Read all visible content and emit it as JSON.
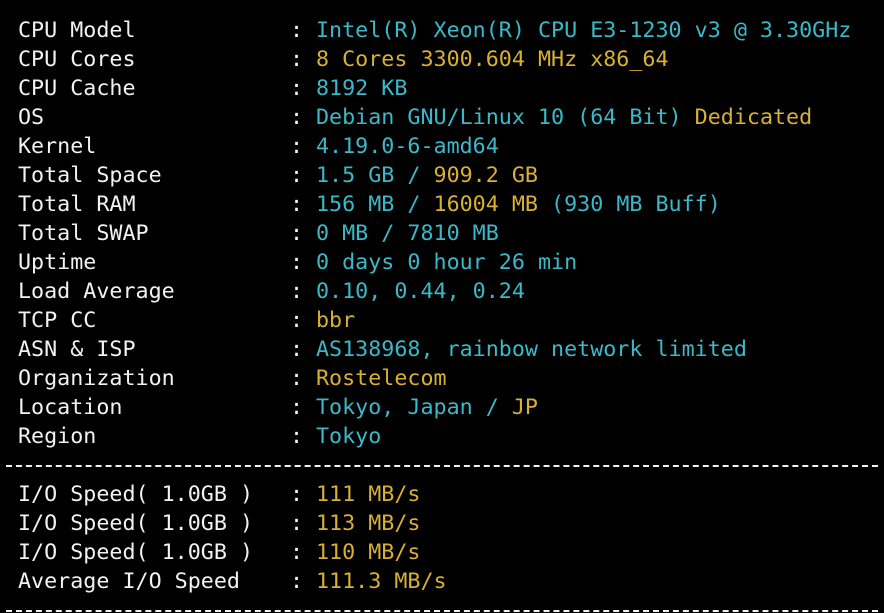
{
  "colors": {
    "background": "#000000",
    "label": "#f2f2f2",
    "cyan": "#3bb9c9",
    "yellow": "#d8b032"
  },
  "info_rows": [
    {
      "label": "CPU Model",
      "parts": [
        {
          "text": "Intel(R) Xeon(R) CPU E3-1230 v3 @ 3.30GHz",
          "color": "cyan"
        }
      ]
    },
    {
      "label": "CPU Cores",
      "parts": [
        {
          "text": "8 Cores 3300.604 MHz x86_64",
          "color": "yellow"
        }
      ]
    },
    {
      "label": "CPU Cache",
      "parts": [
        {
          "text": "8192 KB",
          "color": "cyan"
        }
      ]
    },
    {
      "label": "OS",
      "parts": [
        {
          "text": "Debian GNU/Linux 10 (64 Bit) ",
          "color": "cyan"
        },
        {
          "text": "Dedicated",
          "color": "yellow"
        }
      ]
    },
    {
      "label": "Kernel",
      "parts": [
        {
          "text": "4.19.0-6-amd64",
          "color": "cyan"
        }
      ]
    },
    {
      "label": "Total Space",
      "parts": [
        {
          "text": "1.5 GB / ",
          "color": "cyan"
        },
        {
          "text": "909.2 GB",
          "color": "yellow"
        }
      ]
    },
    {
      "label": "Total RAM",
      "parts": [
        {
          "text": "156 MB / ",
          "color": "cyan"
        },
        {
          "text": "16004 MB",
          "color": "yellow"
        },
        {
          "text": " (930 MB Buff)",
          "color": "cyan"
        }
      ]
    },
    {
      "label": "Total SWAP",
      "parts": [
        {
          "text": "0 MB / 7810 MB",
          "color": "cyan"
        }
      ]
    },
    {
      "label": "Uptime",
      "parts": [
        {
          "text": "0 days 0 hour 26 min",
          "color": "cyan"
        }
      ]
    },
    {
      "label": "Load Average",
      "parts": [
        {
          "text": "0.10, 0.44, 0.24",
          "color": "cyan"
        }
      ]
    },
    {
      "label": "TCP CC",
      "parts": [
        {
          "text": "bbr",
          "color": "yellow"
        }
      ]
    },
    {
      "label": "ASN & ISP",
      "parts": [
        {
          "text": "AS138968, rainbow network limited",
          "color": "cyan"
        }
      ]
    },
    {
      "label": "Organization",
      "parts": [
        {
          "text": "Rostelecom",
          "color": "yellow"
        }
      ]
    },
    {
      "label": "Location",
      "parts": [
        {
          "text": "Tokyo, Japan / ",
          "color": "cyan"
        },
        {
          "text": "JP",
          "color": "yellow"
        }
      ]
    },
    {
      "label": "Region",
      "parts": [
        {
          "text": "Tokyo",
          "color": "cyan"
        }
      ]
    }
  ],
  "io_rows": [
    {
      "label": "I/O Speed( 1.0GB )",
      "parts": [
        {
          "text": "111 MB/s",
          "color": "yellow"
        }
      ]
    },
    {
      "label": "I/O Speed( 1.0GB )",
      "parts": [
        {
          "text": "113 MB/s",
          "color": "yellow"
        }
      ]
    },
    {
      "label": "I/O Speed( 1.0GB )",
      "parts": [
        {
          "text": "110 MB/s",
          "color": "yellow"
        }
      ]
    },
    {
      "label": "Average I/O Speed",
      "parts": [
        {
          "text": "111.3 MB/s",
          "color": "yellow"
        }
      ]
    }
  ],
  "separator": ":"
}
